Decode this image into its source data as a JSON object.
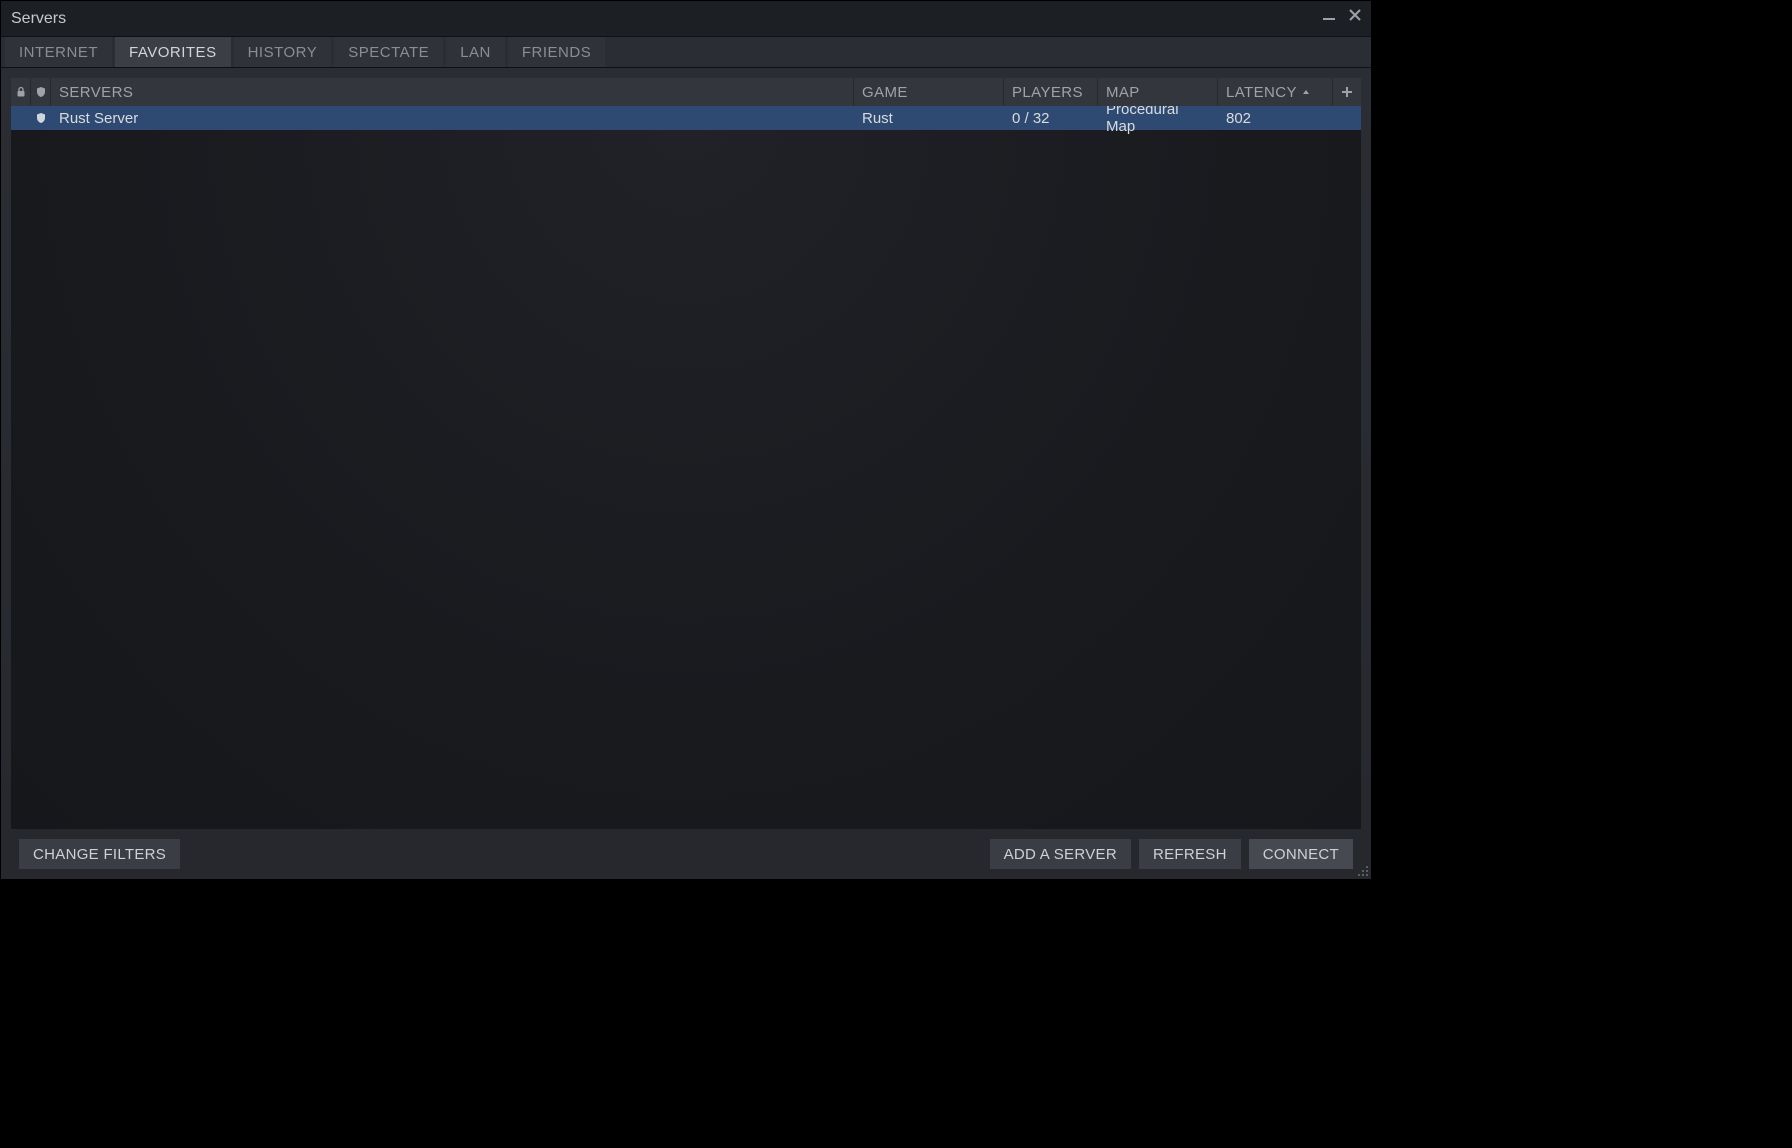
{
  "window": {
    "title": "Servers"
  },
  "tabs": [
    {
      "id": "internet",
      "label": "INTERNET",
      "active": false
    },
    {
      "id": "favorites",
      "label": "FAVORITES",
      "active": true
    },
    {
      "id": "history",
      "label": "HISTORY",
      "active": false
    },
    {
      "id": "spectate",
      "label": "SPECTATE",
      "active": false
    },
    {
      "id": "lan",
      "label": "LAN",
      "active": false
    },
    {
      "id": "friends",
      "label": "FRIENDS",
      "active": false
    }
  ],
  "columns": {
    "servers": "SERVERS",
    "game": "GAME",
    "players": "PLAYERS",
    "map": "MAP",
    "latency": "LATENCY"
  },
  "sort": {
    "column": "latency",
    "direction": "asc"
  },
  "rows": [
    {
      "locked": false,
      "vac": true,
      "name": "Rust Server",
      "game": "Rust",
      "players": "0 / 32",
      "map": "Procedural Map",
      "latency": "802",
      "selected": true
    }
  ],
  "footer": {
    "change_filters": "CHANGE FILTERS",
    "add_server": "ADD A SERVER",
    "refresh": "REFRESH",
    "connect": "CONNECT"
  }
}
